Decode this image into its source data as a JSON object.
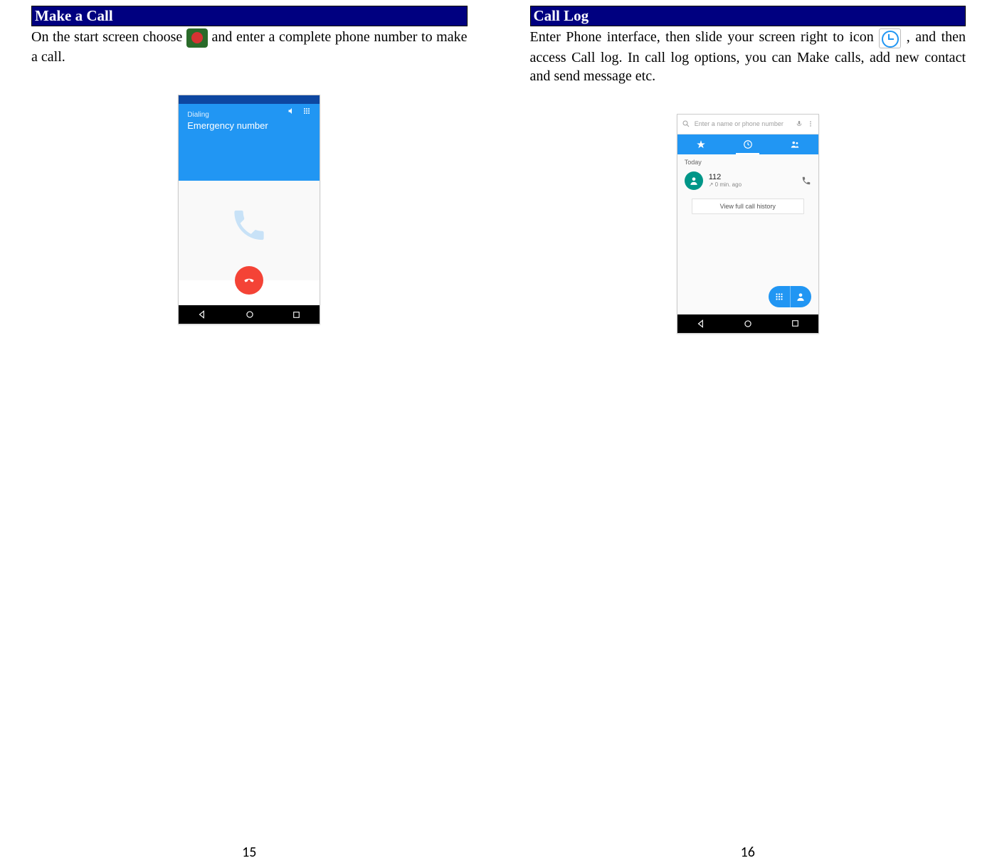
{
  "left": {
    "title": "Make a Call",
    "para_pre": "On the start screen choose ",
    "para_post": "and enter a complete phone number to make a call.",
    "pageNumber": "15",
    "screenshot": {
      "dialingLabel": "Dialing",
      "dialingTitle": "Emergency number"
    }
  },
  "right": {
    "title": "Call Log",
    "para_pre": "Enter Phone interface, then slide your screen right to icon ",
    "para_post": ", and then access Call log. In call log options, you can Make calls, add new contact and send message etc.",
    "pageNumber": "16",
    "screenshot": {
      "searchPlaceholder": "Enter a name or phone number",
      "todayLabel": "Today",
      "logNumber": "112",
      "logTime": "↗ 0 min. ago",
      "viewFull": "View full call history"
    }
  }
}
